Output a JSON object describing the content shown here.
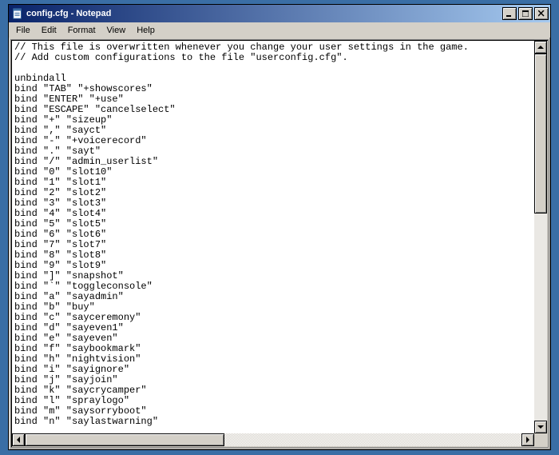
{
  "window": {
    "title": "config.cfg - Notepad"
  },
  "menu": {
    "file": "File",
    "edit": "Edit",
    "format": "Format",
    "view": "View",
    "help": "Help"
  },
  "editor": {
    "content": "// This file is overwritten whenever you change your user settings in the game.\n// Add custom configurations to the file \"userconfig.cfg\".\n\nunbindall\nbind \"TAB\" \"+showscores\"\nbind \"ENTER\" \"+use\"\nbind \"ESCAPE\" \"cancelselect\"\nbind \"+\" \"sizeup\"\nbind \",\" \"sayct\"\nbind \"-\" \"+voicerecord\"\nbind \".\" \"sayt\"\nbind \"/\" \"admin_userlist\"\nbind \"0\" \"slot10\"\nbind \"1\" \"slot1\"\nbind \"2\" \"slot2\"\nbind \"3\" \"slot3\"\nbind \"4\" \"slot4\"\nbind \"5\" \"slot5\"\nbind \"6\" \"slot6\"\nbind \"7\" \"slot7\"\nbind \"8\" \"slot8\"\nbind \"9\" \"slot9\"\nbind \"]\" \"snapshot\"\nbind \"`\" \"toggleconsole\"\nbind \"a\" \"sayadmin\"\nbind \"b\" \"buy\"\nbind \"c\" \"sayceremony\"\nbind \"d\" \"sayeven1\"\nbind \"e\" \"sayeven\"\nbind \"f\" \"saybookmark\"\nbind \"h\" \"nightvision\"\nbind \"i\" \"sayignore\"\nbind \"j\" \"sayjoin\"\nbind \"k\" \"saycrycamper\"\nbind \"l\" \"spraylogo\"\nbind \"m\" \"saysorryboot\"\nbind \"n\" \"saylastwarning\""
  }
}
